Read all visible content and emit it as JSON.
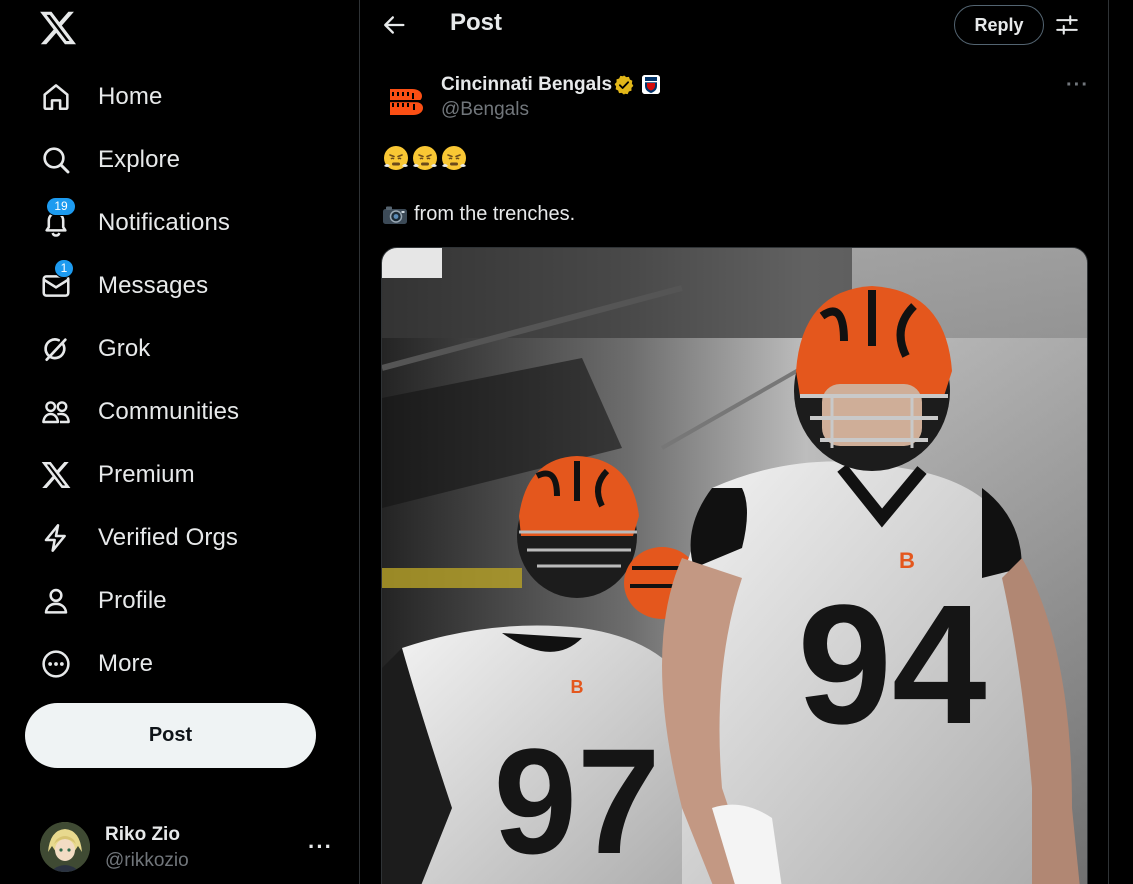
{
  "app": {
    "logo_icon": "x-logo-icon"
  },
  "sidebar": {
    "items": [
      {
        "label": "Home",
        "icon": "home-icon"
      },
      {
        "label": "Explore",
        "icon": "search-icon"
      },
      {
        "label": "Notifications",
        "icon": "bell-icon",
        "badge": "19"
      },
      {
        "label": "Messages",
        "icon": "mail-icon",
        "badge": "1"
      },
      {
        "label": "Grok",
        "icon": "grok-icon"
      },
      {
        "label": "Communities",
        "icon": "communities-icon"
      },
      {
        "label": "Premium",
        "icon": "x-icon"
      },
      {
        "label": "Verified Orgs",
        "icon": "lightning-icon"
      },
      {
        "label": "Profile",
        "icon": "person-icon"
      },
      {
        "label": "More",
        "icon": "more-circle-icon"
      }
    ],
    "post_button": "Post",
    "account": {
      "name": "Riko Zio",
      "handle": "@rikkozio",
      "more": "···"
    }
  },
  "header": {
    "title": "Post",
    "reply_button": "Reply"
  },
  "post": {
    "author_name": "Cincinnati Bengals",
    "author_handle": "@Bengals",
    "more": "···",
    "emoji_line": "😤😤😤",
    "caption": "from the trenches.",
    "jerseys": [
      "94",
      "97"
    ]
  },
  "colors": {
    "background": "#000000",
    "accent_blue": "#1d9bf0",
    "bengals_orange": "#fb4f14",
    "verified_gold": "#e2b719",
    "text_primary": "#e7e9ea",
    "text_secondary": "#71767b"
  }
}
